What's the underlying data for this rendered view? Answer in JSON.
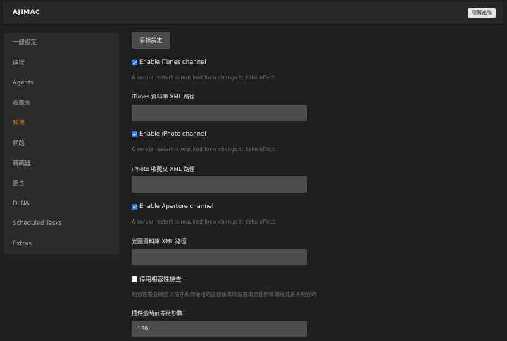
{
  "header": {
    "app_title": "AJIMAC",
    "hide_advanced_label": "隱藏進階"
  },
  "sidebar": {
    "items": [
      {
        "label": "一般設定",
        "active": false
      },
      {
        "label": "連接",
        "active": false
      },
      {
        "label": "Agents",
        "active": false
      },
      {
        "label": "收藏夾",
        "active": false
      },
      {
        "label": "頻道",
        "active": true
      },
      {
        "label": "網路",
        "active": false
      },
      {
        "label": "轉碼器",
        "active": false
      },
      {
        "label": "語言",
        "active": false
      },
      {
        "label": "DLNA",
        "active": false
      },
      {
        "label": "Scheduled Tasks",
        "active": false
      },
      {
        "label": "Extras",
        "active": false
      }
    ]
  },
  "main": {
    "directory_button_label": "目錄設定",
    "itunes": {
      "checkbox_label": "Enable iTunes channel",
      "checked": true,
      "help": "A server restart is required for a change to take effect.",
      "path_label": "iTunes 資料庫 XML 路徑",
      "path_value": ""
    },
    "iphoto": {
      "checkbox_label": "Enable iPhoto channel",
      "checked": true,
      "help": "A server restart is required for a change to take effect.",
      "path_label": "iPhoto 收藏夾 XML 路徑",
      "path_value": ""
    },
    "aperture": {
      "checkbox_label": "Enable Aperture channel",
      "checked": true,
      "help": "A server restart is required for a change to take effect.",
      "path_label": "光圈資料庫 XML 路徑",
      "path_value": ""
    },
    "compat": {
      "checkbox_label": "停用相容性檢查",
      "checked": false,
      "help": "相容性檢查確認了插件和你使用的這個版本伺服器或現在的客端程式是不相容的"
    },
    "timeout": {
      "label": "插件逾時前等待秒數",
      "value": "180"
    }
  },
  "colors": {
    "background": "#1f1f1f",
    "sidebar_bg": "#2b2b2b",
    "active_accent": "#cc7b19",
    "checkbox_checked": "#2f7ae5",
    "input_bg": "#4d4d4d"
  }
}
